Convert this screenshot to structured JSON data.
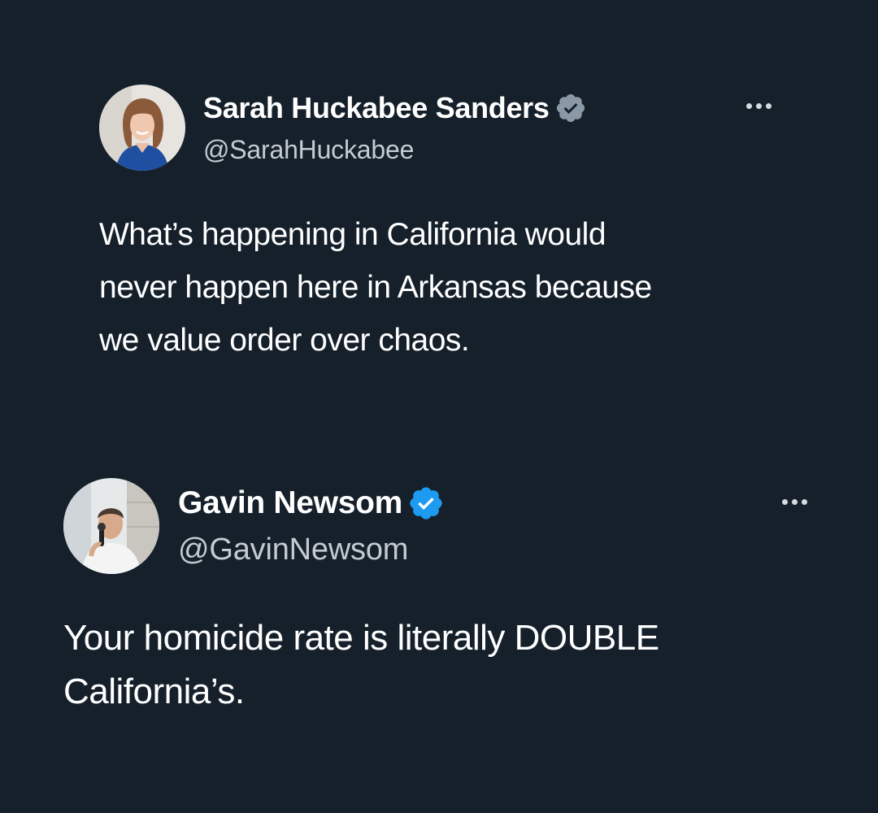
{
  "tweets": [
    {
      "display_name": "Sarah Huckabee Sanders",
      "handle": "@SarahHuckabee",
      "verified_badge": "verified-badge-gray",
      "badge_color": "#8b98a5",
      "avatar_icon": "profile-photo",
      "more_icon": "more-options-icon",
      "body_lines": [
        "What’s happening in California would",
        "never happen here in Arkansas because",
        "we value order over chaos."
      ]
    },
    {
      "display_name": "Gavin Newsom",
      "handle": "@GavinNewsom",
      "verified_badge": "verified-badge-blue",
      "badge_color": "#1d9bf0",
      "avatar_icon": "profile-photo",
      "more_icon": "more-options-icon",
      "body_lines": [
        "Your homicide rate is literally DOUBLE",
        "California’s."
      ]
    }
  ],
  "colors": {
    "background": "#15202b",
    "text": "#ffffff",
    "handle": "#c4cbd2"
  }
}
